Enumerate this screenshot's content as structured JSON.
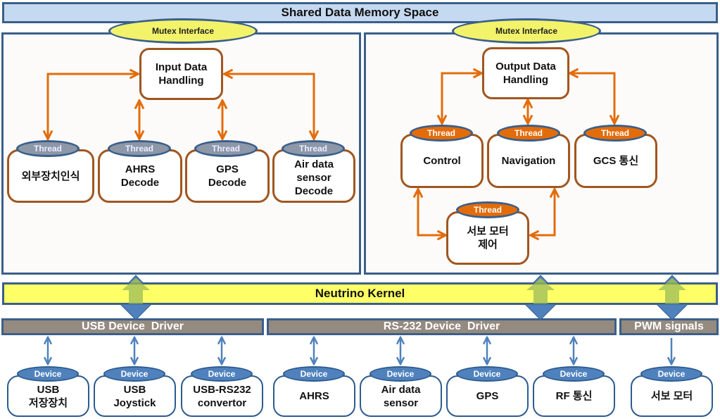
{
  "shared_memory": {
    "label": "Shared Data Memory Space"
  },
  "left_panel": {
    "mutex_label": "Mutex Interface",
    "handler_label": "Input Data\nHandling",
    "threads": [
      {
        "badge": "Thread",
        "label": "외부장치인식"
      },
      {
        "badge": "Thread",
        "label": "AHRS\nDecode"
      },
      {
        "badge": "Thread",
        "label": "GPS\nDecode"
      },
      {
        "badge": "Thread",
        "label": "Air data\nsensor\nDecode"
      }
    ]
  },
  "right_panel": {
    "mutex_label": "Mutex Interface",
    "handler_label": "Output Data\nHandling",
    "threads": [
      {
        "badge": "Thread",
        "label": "Control"
      },
      {
        "badge": "Thread",
        "label": "Navigation"
      },
      {
        "badge": "Thread",
        "label": "GCS 통신"
      },
      {
        "badge": "Thread",
        "label": "서보 모터\n제어"
      }
    ]
  },
  "kernel": {
    "label": "Neutrino Kernel"
  },
  "drivers": [
    {
      "label": "USB Device  Driver"
    },
    {
      "label": "RS-232 Device  Driver"
    },
    {
      "label": "PWM signals"
    }
  ],
  "devices": [
    {
      "badge": "Device",
      "label": "USB\n저장장치"
    },
    {
      "badge": "Device",
      "label": "USB\nJoystick"
    },
    {
      "badge": "Device",
      "label": "USB-RS232\nconvertor"
    },
    {
      "badge": "Device",
      "label": "AHRS"
    },
    {
      "badge": "Device",
      "label": "Air data\nsensor"
    },
    {
      "badge": "Device",
      "label": "GPS"
    },
    {
      "badge": "Device",
      "label": "RF 통신"
    },
    {
      "badge": "Device",
      "label": "서보 모터"
    }
  ],
  "colors": {
    "panel_border": "#3b5f8a",
    "shared_fill": "#c5d9f1",
    "mutex_fill": "#f2f36a",
    "thread_box_border": "#a0561f",
    "thread_arrow": "#e36c0a",
    "input_thread_badge": "#8c97a8",
    "output_thread_badge": "#e36c0a",
    "kernel_fill": "#ffff66",
    "driver_fill": "#948a80",
    "device_badge": "#4f81bd",
    "kernel_arrow_blue": "#4f81bd",
    "kernel_arrow_olive": "#9bbb59"
  }
}
